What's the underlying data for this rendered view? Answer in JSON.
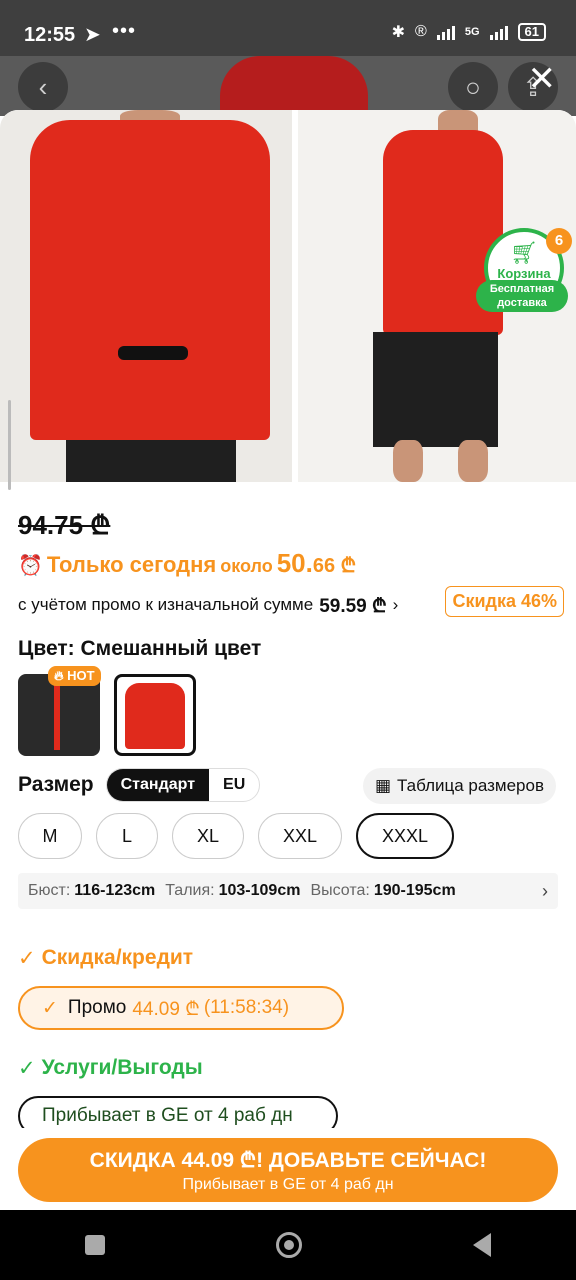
{
  "status": {
    "time": "12:55",
    "battery": "61",
    "net": "5G"
  },
  "product": {
    "old_price": "94.75 ₾",
    "today_label": "Только сегодня",
    "about": "около",
    "deal_price_int": "50.",
    "deal_price_dec": "66 ₾",
    "promo_text": "с учётом промо к изначальной сумме",
    "promo_value": "59.59 ₾",
    "discount_badge": "Скидка 46%"
  },
  "cart": {
    "label": "Корзина",
    "count": "6",
    "free_shipping": "Бесплатная доставка"
  },
  "color": {
    "title": "Цвет: Смешанный цвет",
    "hot": "HOT"
  },
  "size": {
    "title": "Размер",
    "standards": [
      "Стандарт",
      "EU"
    ],
    "chart": "Таблица размеров",
    "options": [
      "M",
      "L",
      "XL",
      "XXL",
      "XXXL"
    ],
    "selected": "XXXL"
  },
  "measurements": {
    "bust_label": "Бюст:",
    "bust": "116-123cm",
    "waist_label": "Талия:",
    "waist": "103-109cm",
    "height_label": "Высота:",
    "height": "190-195cm"
  },
  "discount_section": {
    "title": "Скидка/кредит",
    "promo_label": "Промо",
    "promo_amount": "44.09 ₾",
    "timer": "(11:58:34)"
  },
  "services_section": {
    "title": "Услуги/Выгоды",
    "shipping": "Прибывает в GE от 4 раб дн"
  },
  "cta": {
    "title": "СКИДКА 44.09 ₾! ДОБАВЬТЕ СЕЙЧАС!",
    "subtitle": "Прибывает в GE от 4 раб дн"
  },
  "colors": {
    "accent": "#f7931e",
    "green": "#2db34a",
    "jacket": "#e02a1c"
  }
}
